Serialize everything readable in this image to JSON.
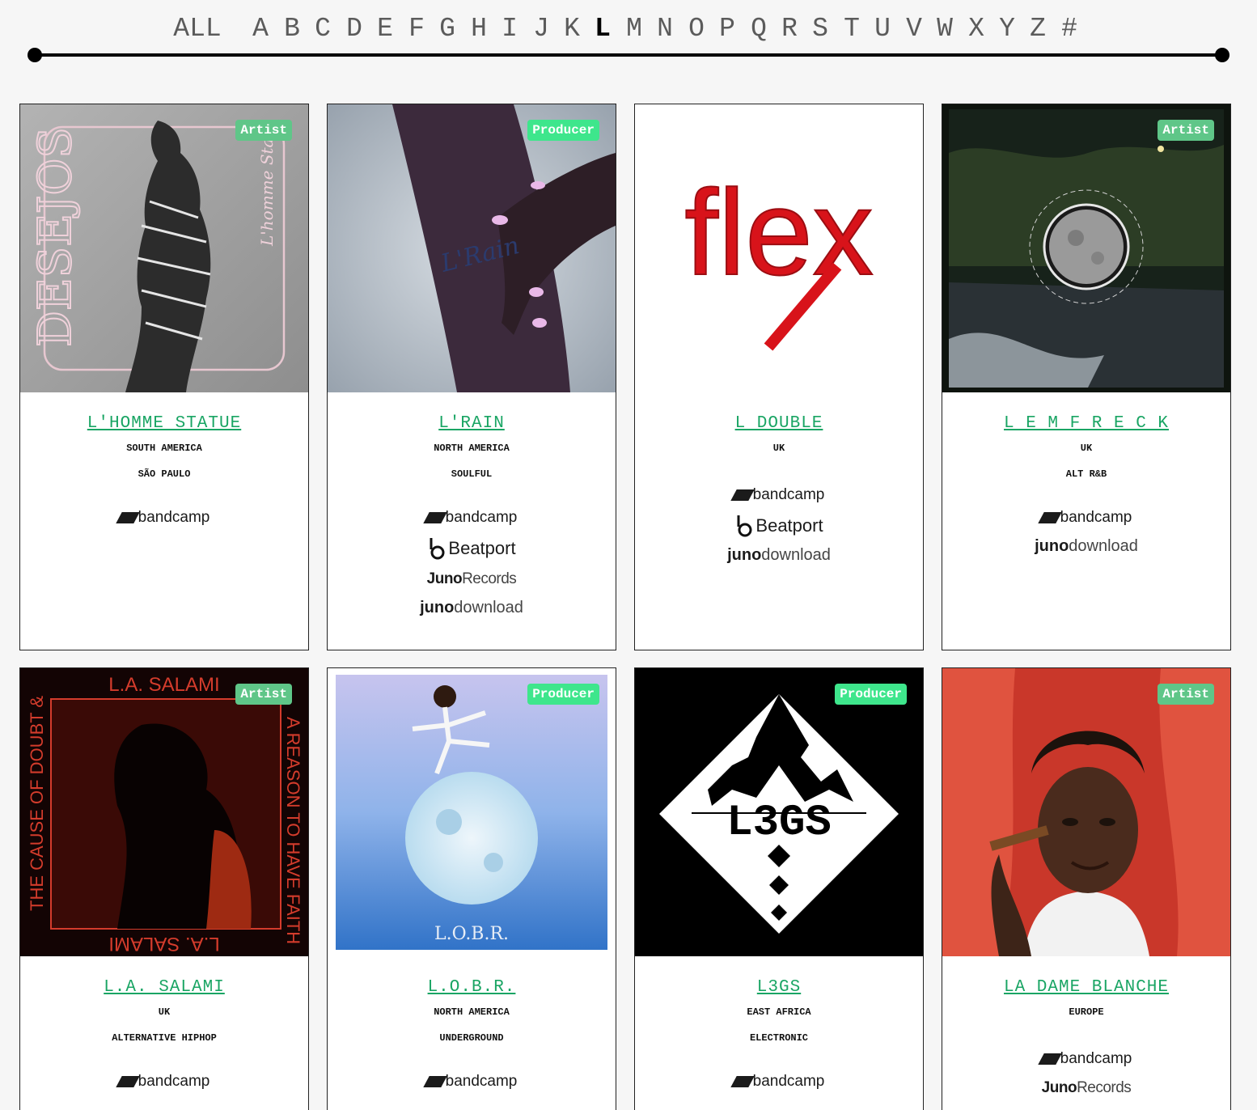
{
  "nav": {
    "all_label": "ALL",
    "letters": [
      "A",
      "B",
      "C",
      "D",
      "E",
      "F",
      "G",
      "H",
      "I",
      "J",
      "K",
      "L",
      "M",
      "N",
      "O",
      "P",
      "Q",
      "R",
      "S",
      "T",
      "U",
      "V",
      "W",
      "X",
      "Y",
      "Z",
      "#"
    ],
    "active": "L"
  },
  "links": {
    "bandcamp": "bandcamp",
    "beatport": "Beatport",
    "junorecords_bold": "Juno",
    "junorecords_rest": "Records",
    "junodownload_bold": "juno",
    "junodownload_rest": "download"
  },
  "cards": [
    {
      "name": "L'HOMME STATUE",
      "region": "SOUTH AMERICA",
      "detail": "SÃO PAULO",
      "badge": "Artist",
      "art_text": {
        "title": "DESEJOS",
        "subtitle": "L'homme Statu"
      }
    },
    {
      "name": "L'RAIN",
      "region": "NORTH AMERICA",
      "detail": "SOULFUL",
      "badge": "Producer",
      "art_text": {
        "tattoo": "L'Rain"
      }
    },
    {
      "name": "L DOUBLE",
      "region": "UK",
      "detail": "",
      "badge": "",
      "art_text": {
        "logo": "flex"
      }
    },
    {
      "name": "L E M F R E C K",
      "region": "UK",
      "detail": "ALT R&B",
      "badge": "Artist",
      "art_text": {}
    },
    {
      "name": "L.A. SALAMI",
      "region": "UK",
      "detail": "ALTERNATIVE HIPHOP",
      "badge": "Artist",
      "art_text": {
        "top": "L.A. SALAMI",
        "left": "THE CAUSE OF DOUBT &",
        "right": "A REASON TO HAVE FAITH",
        "bottom": "L.A. SALAMI"
      }
    },
    {
      "name": "L.O.B.R.",
      "region": "NORTH AMERICA",
      "detail": "UNDERGROUND",
      "badge": "Producer",
      "art_text": {
        "caption": "L.O.B.R."
      }
    },
    {
      "name": "L3GS",
      "region": "EAST AFRICA",
      "detail": "ELECTRONIC",
      "badge": "Producer",
      "art_text": {
        "logo": "L3GS"
      }
    },
    {
      "name": "LA DAME BLANCHE",
      "region": "EUROPE",
      "detail": "",
      "badge": "Artist",
      "art_text": {}
    }
  ],
  "colors": {
    "accent_link": "#1aa564",
    "badge_artist": "#5fc688",
    "badge_producer": "#3ee68c"
  }
}
